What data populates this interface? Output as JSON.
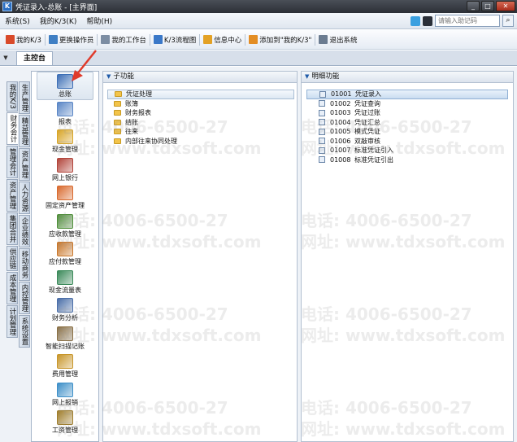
{
  "window": {
    "title": "凭证录入-总账 - [主界面]"
  },
  "menubar": {
    "items": [
      "系统(S)",
      "我的K/3(K)",
      "帮助(H)"
    ],
    "helper_placeholder": "请输入助记码"
  },
  "toolbar": {
    "items": [
      {
        "label": "我的K/3",
        "icon": "my-k3-icon",
        "color": "#d94a2a"
      },
      {
        "label": "更换操作员",
        "icon": "change-user-icon",
        "color": "#3f7fc4"
      },
      {
        "label": "我的工作台",
        "icon": "workbench-icon",
        "color": "#7c8da3"
      },
      {
        "label": "K/3流程图",
        "icon": "flowchart-icon",
        "color": "#3a78c8"
      },
      {
        "label": "信息中心",
        "icon": "info-center-icon",
        "color": "#e3a124"
      },
      {
        "label": "添加到\"我的K/3\"",
        "icon": "add-favorite-icon",
        "color": "#e38d24"
      },
      {
        "label": "退出系统",
        "icon": "exit-icon",
        "color": "#6a7b90"
      }
    ]
  },
  "tabs": {
    "main": "主控台"
  },
  "vertical_tabs": {
    "col1": [
      "我的K/3",
      "财务会计",
      "管理会计",
      "资产管理",
      "集团合并",
      "供应链",
      "成本管理",
      "计划管理"
    ],
    "col2": [
      "生产管理",
      "精益管理",
      "资产管理",
      "人力资源",
      "企业绩效",
      "移动商务",
      "内控管理",
      "系统设置"
    ]
  },
  "modules": [
    {
      "label": "总账",
      "icon": "general-ledger-icon",
      "color": "#3d6fb6"
    },
    {
      "label": "报表",
      "icon": "report-icon",
      "color": "#5a86c6"
    },
    {
      "label": "现金管理",
      "icon": "cash-management-icon",
      "color": "#d8a526"
    },
    {
      "label": "网上银行",
      "icon": "online-bank-icon",
      "color": "#b2443a"
    },
    {
      "label": "固定资产管理",
      "icon": "fixed-assets-icon",
      "color": "#d96a2e"
    },
    {
      "label": "应收款管理",
      "icon": "receivables-icon",
      "color": "#4f8f3a"
    },
    {
      "label": "应付款管理",
      "icon": "payables-icon",
      "color": "#c9772a"
    },
    {
      "label": "现金流量表",
      "icon": "cash-flow-icon",
      "color": "#3b8a5a"
    },
    {
      "label": "财务分析",
      "icon": "financial-analysis-icon",
      "color": "#4a6ea8"
    },
    {
      "label": "智能扫描记账",
      "icon": "smart-scan-icon",
      "color": "#8a7045"
    },
    {
      "label": "费用管理",
      "icon": "expense-icon",
      "color": "#c8962a"
    },
    {
      "label": "网上报销",
      "icon": "online-reimburse-icon",
      "color": "#3d8fc8"
    },
    {
      "label": "工资管理",
      "icon": "payroll-icon",
      "color": "#a07e2c"
    }
  ],
  "subfunctions": {
    "header": "子功能",
    "items": [
      "凭证处理",
      "账簿",
      "财务报表",
      "结账",
      "往来",
      "内部往来协同处理"
    ]
  },
  "details": {
    "header": "明细功能",
    "items": [
      {
        "code": "01001",
        "label": "凭证录入"
      },
      {
        "code": "01002",
        "label": "凭证查询"
      },
      {
        "code": "01003",
        "label": "凭证过账"
      },
      {
        "code": "01004",
        "label": "凭证汇总"
      },
      {
        "code": "01005",
        "label": "模式凭证"
      },
      {
        "code": "01006",
        "label": "双敲审核"
      },
      {
        "code": "01007",
        "label": "标准凭证引入"
      },
      {
        "code": "01008",
        "label": "标准凭证引出"
      }
    ]
  },
  "watermarks": {
    "phone": "电话: 4006-6500-27",
    "site": "网址: www.tdxsoft.com"
  },
  "colors": {
    "accent": "#1e5aa8",
    "arrow": "#e03a2a"
  }
}
